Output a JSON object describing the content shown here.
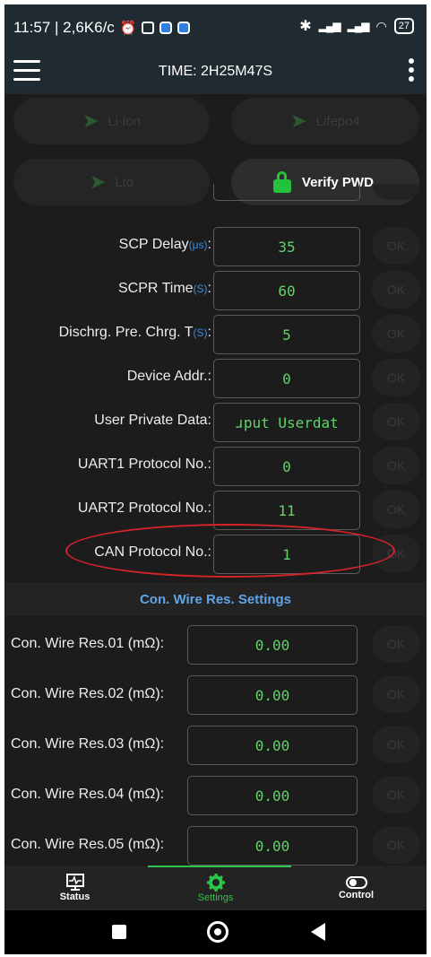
{
  "status_bar": {
    "time_speed": "11:57 | 2,6K6/c",
    "battery": "27"
  },
  "app_bar": {
    "title": "TIME: 2H25M47S"
  },
  "presets": {
    "li_ion": "Li-ion",
    "lifepo4": "Lifepo4",
    "lto": "Lto",
    "verify": "Verify PWD."
  },
  "settings": [
    {
      "label": "SCP Delay",
      "unit": "(μs)",
      "suffix": ":",
      "value": "35",
      "ok": "OK"
    },
    {
      "label": "SCPR Time",
      "unit": "(S)",
      "suffix": ":",
      "value": "60",
      "ok": "OK"
    },
    {
      "label": "Dischrg. Pre. Chrg. T",
      "unit": "(S)",
      "suffix": ":",
      "value": "5",
      "ok": "OK"
    },
    {
      "label": "Device Addr.:",
      "unit": "",
      "suffix": "",
      "value": "0",
      "ok": "OK"
    },
    {
      "label": "User Private Data:",
      "unit": "",
      "suffix": "",
      "value": "ɹput Userdat",
      "ok": "OK"
    },
    {
      "label": "UART1 Protocol No.:",
      "unit": "",
      "suffix": "",
      "value": "0",
      "ok": "OK"
    },
    {
      "label": "UART2 Protocol No.:",
      "unit": "",
      "suffix": "",
      "value": "11",
      "ok": "OK"
    },
    {
      "label": "CAN Protocol No.:",
      "unit": "",
      "suffix": "",
      "value": "1",
      "ok": "OK"
    }
  ],
  "section": {
    "title": "Con. Wire Res. Settings"
  },
  "wires": [
    {
      "label": "Con. Wire Res.01 (mΩ):",
      "value": "0.00",
      "ok": "OK"
    },
    {
      "label": "Con. Wire Res.02 (mΩ):",
      "value": "0.00",
      "ok": "OK"
    },
    {
      "label": "Con. Wire Res.03 (mΩ):",
      "value": "0.00",
      "ok": "OK"
    },
    {
      "label": "Con. Wire Res.04 (mΩ):",
      "value": "0.00",
      "ok": "OK"
    },
    {
      "label": "Con. Wire Res.05 (mΩ):",
      "value": "0.00",
      "ok": "OK"
    }
  ],
  "nav": {
    "status": "Status",
    "settings": "Settings",
    "control": "Control",
    "active": "settings"
  },
  "colors": {
    "accent": "#2fc44a",
    "value_text": "#5fd36a",
    "unit_text": "#3e8edb",
    "highlight_ring": "#d5232a"
  }
}
